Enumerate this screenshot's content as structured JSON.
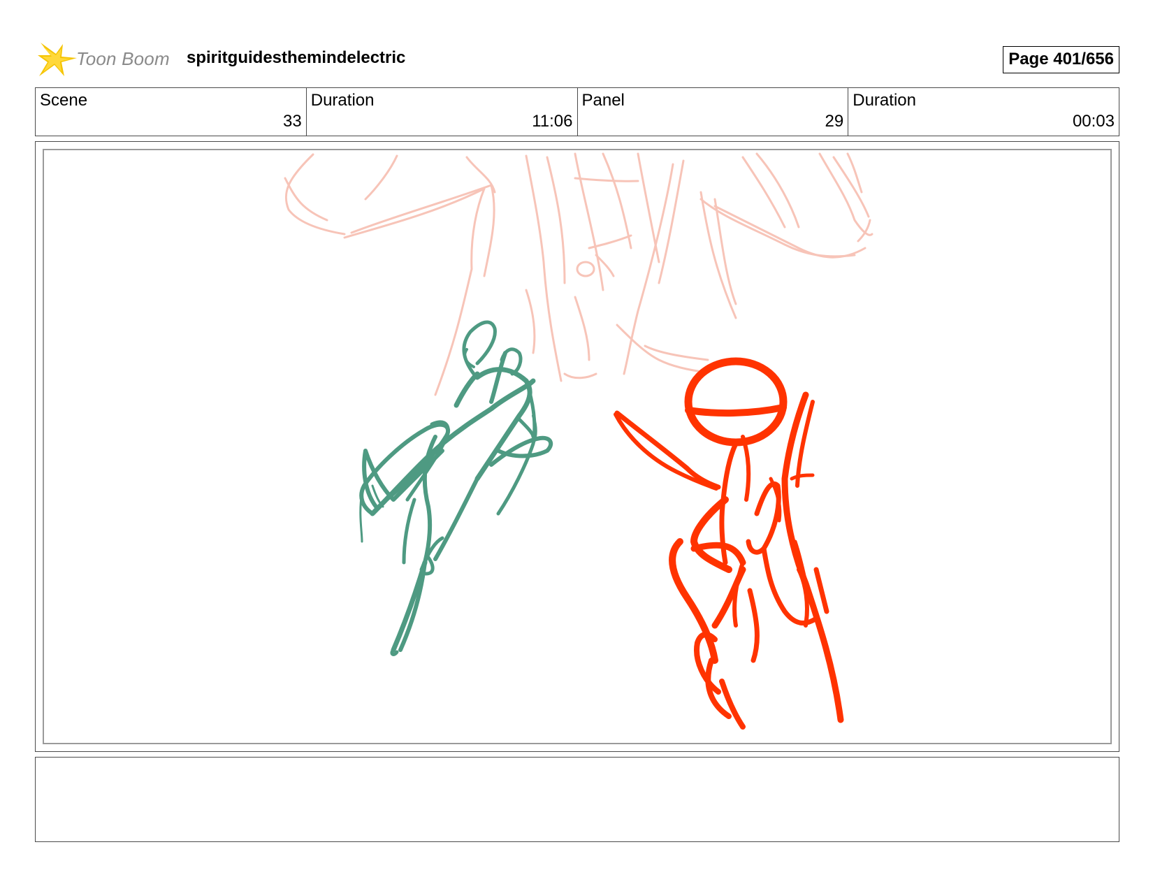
{
  "header": {
    "logo_text": "Toon Boom",
    "project_title": "spiritguidesthemindelectric",
    "page_indicator": "Page 401/656"
  },
  "info": {
    "scene_label": "Scene",
    "scene_value": "33",
    "scene_duration_label": "Duration",
    "scene_duration_value": "11:06",
    "panel_label": "Panel",
    "panel_value": "29",
    "panel_duration_label": "Duration",
    "panel_duration_value": "00:03"
  },
  "caption": {
    "text": ""
  },
  "colors": {
    "background_sketch": "#f7c4b8",
    "green_figure": "#4e9a82",
    "red_figure": "#ff3300",
    "logo_star": "#f5c400",
    "logo_text": "#8a8a8a"
  }
}
